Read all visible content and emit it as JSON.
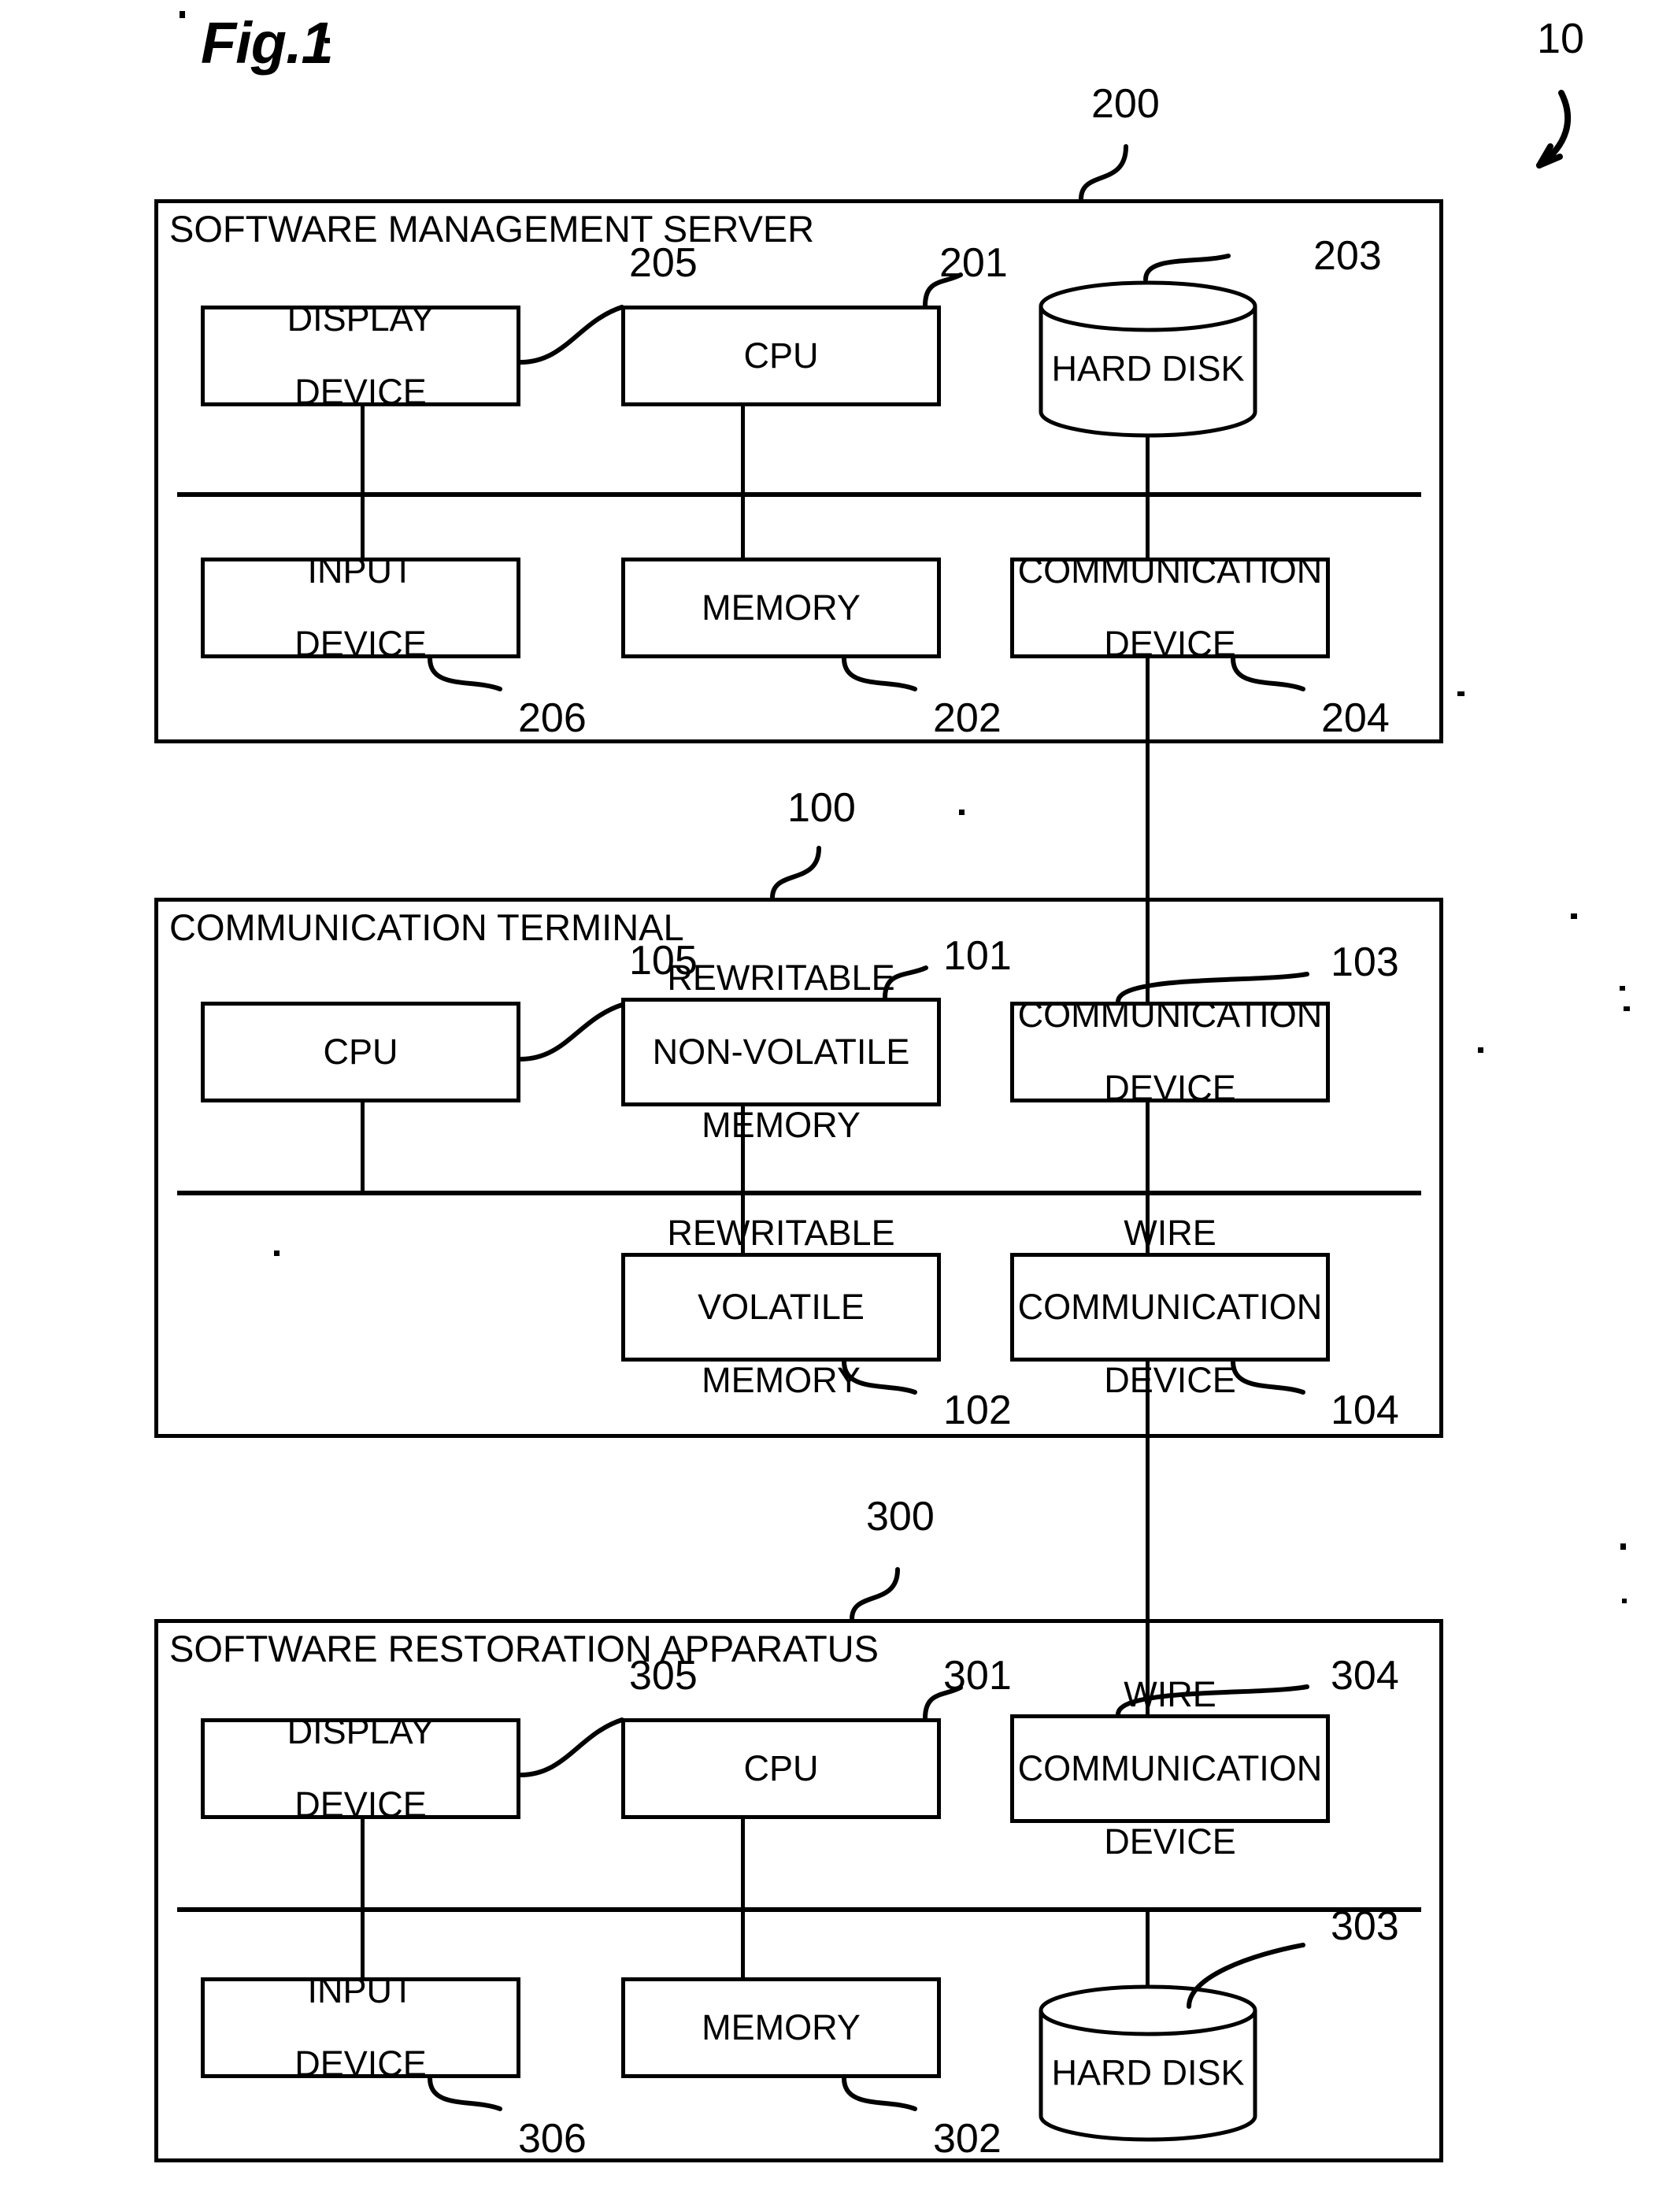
{
  "figure": {
    "title": "Fig.1",
    "system_ref": "10"
  },
  "blocks": [
    {
      "id": "software-management-server",
      "title": "SOFTWARE MANAGEMENT SERVER",
      "ref": "200",
      "components": [
        {
          "id": "display-device",
          "label": "DISPLAY\nDEVICE",
          "ref": "205",
          "shape": "box"
        },
        {
          "id": "cpu",
          "label": "CPU",
          "ref": "201",
          "shape": "box"
        },
        {
          "id": "hard-disk",
          "label": "HARD DISK",
          "ref": "203",
          "shape": "cylinder"
        },
        {
          "id": "input-device",
          "label": "INPUT\nDEVICE",
          "ref": "206",
          "shape": "box"
        },
        {
          "id": "memory",
          "label": "MEMORY",
          "ref": "202",
          "shape": "box"
        },
        {
          "id": "communication-device",
          "label": "COMMUNICATION\nDEVICE",
          "ref": "204",
          "shape": "box"
        }
      ]
    },
    {
      "id": "communication-terminal",
      "title": "COMMUNICATION TERMINAL",
      "ref": "100",
      "components": [
        {
          "id": "cpu",
          "label": "CPU",
          "ref": "105",
          "shape": "box"
        },
        {
          "id": "rewritable-non-volatile-memory",
          "label": "REWRITABLE\nNON-VOLATILE\nMEMORY",
          "ref": "101",
          "shape": "box"
        },
        {
          "id": "communication-device",
          "label": "COMMUNICATION\nDEVICE",
          "ref": "103",
          "shape": "box"
        },
        {
          "id": "rewritable-volatile-memory",
          "label": "REWRITABLE\nVOLATILE\nMEMORY",
          "ref": "102",
          "shape": "box"
        },
        {
          "id": "wire-communication-device",
          "label": "WIRE\nCOMMUNICATION\nDEVICE",
          "ref": "104",
          "shape": "box"
        }
      ]
    },
    {
      "id": "software-restoration-apparatus",
      "title": "SOFTWARE RESTORATION APPARATUS",
      "ref": "300",
      "components": [
        {
          "id": "display-device",
          "label": "DISPLAY\nDEVICE",
          "ref": "305",
          "shape": "box"
        },
        {
          "id": "cpu",
          "label": "CPU",
          "ref": "301",
          "shape": "box"
        },
        {
          "id": "wire-communication-device",
          "label": "WIRE\nCOMMUNICATION\nDEVICE",
          "ref": "304",
          "shape": "box"
        },
        {
          "id": "input-device",
          "label": "INPUT\nDEVICE",
          "ref": "306",
          "shape": "box"
        },
        {
          "id": "memory",
          "label": "MEMORY",
          "ref": "302",
          "shape": "box"
        },
        {
          "id": "hard-disk",
          "label": "HARD DISK",
          "ref": "303",
          "shape": "cylinder"
        }
      ]
    }
  ],
  "labels": {
    "b1_title": "SOFTWARE MANAGEMENT SERVER",
    "b1_display": "DISPLAY",
    "b1_display2": "DEVICE",
    "b1_cpu": "CPU",
    "b1_hdd": "HARD DISK",
    "b1_input": "INPUT",
    "b1_input2": "DEVICE",
    "b1_memory": "MEMORY",
    "b1_comm": "COMMUNICATION",
    "b1_comm2": "DEVICE",
    "b1_ref": "200",
    "b1_r205": "205",
    "b1_r201": "201",
    "b1_r203": "203",
    "b1_r206": "206",
    "b1_r202": "202",
    "b1_r204": "204",
    "b2_title": "COMMUNICATION TERMINAL",
    "b2_cpu": "CPU",
    "b2_nvm1": "REWRITABLE",
    "b2_nvm2": "NON-VOLATILE",
    "b2_nvm3": "MEMORY",
    "b2_comm": "COMMUNICATION",
    "b2_comm2": "DEVICE",
    "b2_vm1": "REWRITABLE",
    "b2_vm2": "VOLATILE",
    "b2_vm3": "MEMORY",
    "b2_wire1": "WIRE",
    "b2_wire2": "COMMUNICATION",
    "b2_wire3": "DEVICE",
    "b2_ref": "100",
    "b2_r105": "105",
    "b2_r101": "101",
    "b2_r103": "103",
    "b2_r102": "102",
    "b2_r104": "104",
    "b3_title": "SOFTWARE RESTORATION APPARATUS",
    "b3_display": "DISPLAY",
    "b3_display2": "DEVICE",
    "b3_cpu": "CPU",
    "b3_wire1": "WIRE",
    "b3_wire2": "COMMUNICATION",
    "b3_wire3": "DEVICE",
    "b3_input": "INPUT",
    "b3_input2": "DEVICE",
    "b3_memory": "MEMORY",
    "b3_hdd": "HARD DISK",
    "b3_ref": "300",
    "b3_r305": "305",
    "b3_r301": "301",
    "b3_r304": "304",
    "b3_r306": "306",
    "b3_r302": "302",
    "b3_r303": "303"
  }
}
